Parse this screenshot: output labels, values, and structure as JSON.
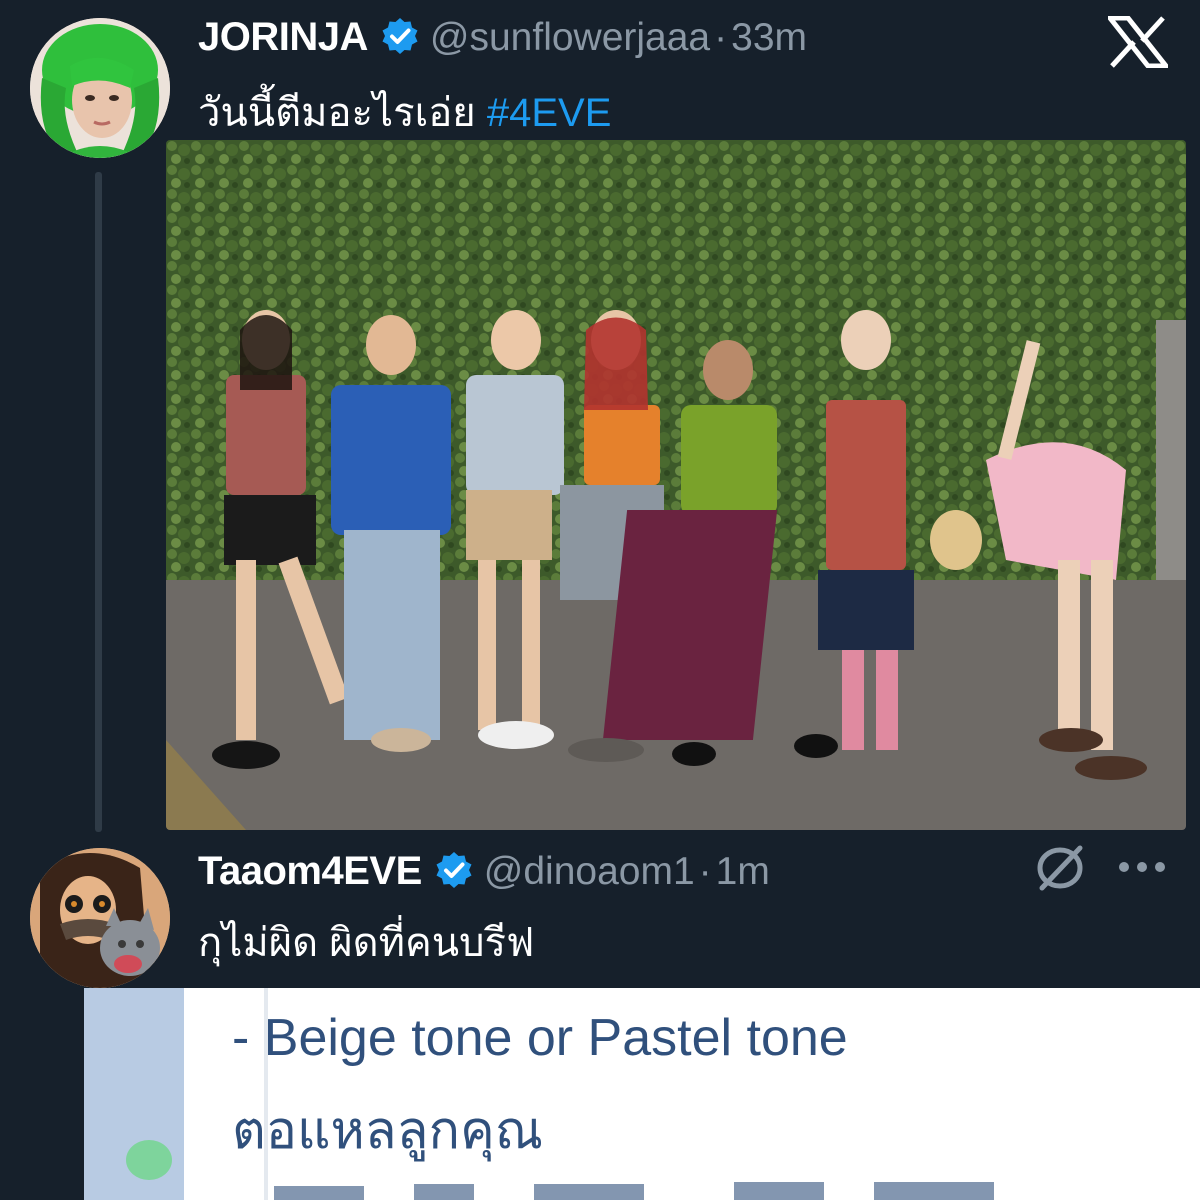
{
  "colors": {
    "background": "#16202b",
    "accent": "#1d9bf0",
    "muted": "#8b98a5",
    "quote_text": "#30507c"
  },
  "tweet1": {
    "display_name": "JORINJA",
    "handle": "@sunflowerjaaa",
    "separator": "·",
    "time": "33m",
    "text": "วันนี้ตีมอะไรเอ่ย",
    "hashtag": "#4EVE",
    "avatar_icon": "avatar-green-hair",
    "verified_icon": "verified-badge-icon",
    "platform_icon": "x-logo-icon"
  },
  "tweet2": {
    "display_name": "Taaom4EVE",
    "handle": "@dinoaom1",
    "separator": "·",
    "time": "1m",
    "text": "กุไม่ผิด ผิดที่คนบรีฟ",
    "avatar_icon": "avatar-cat-filter",
    "verified_icon": "verified-badge-icon",
    "hidden_icon": "eye-slash-icon",
    "more_icon": "more-dots-icon"
  },
  "quote": {
    "line1": "- Beige tone or Pastel tone",
    "line2": "ตอแหลลูกคุณ"
  }
}
